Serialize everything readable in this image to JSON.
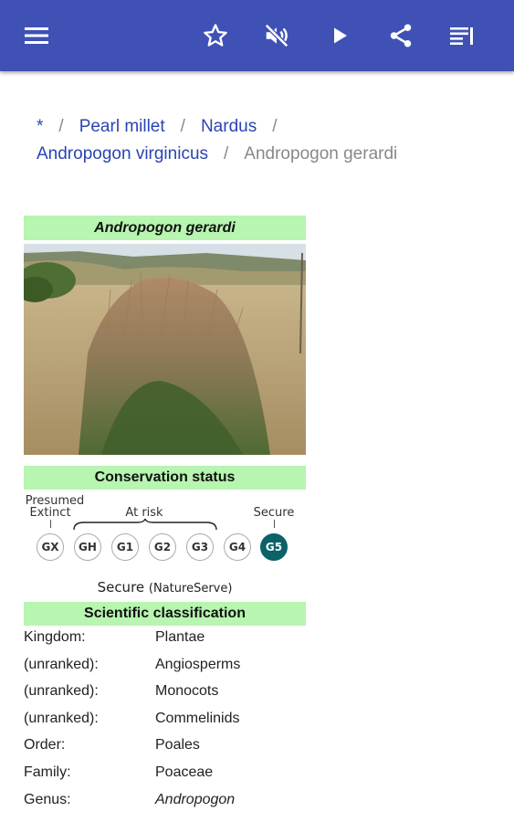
{
  "toolbar": {
    "icons": [
      "menu-icon",
      "star-icon",
      "mute-icon",
      "play-icon",
      "share-icon",
      "list-icon"
    ],
    "color": "#3f51b5"
  },
  "breadcrumb": {
    "items": [
      "*",
      "Pearl millet",
      "Nardus",
      "Andropogon virginicus"
    ],
    "current": "Andropogon gerardi",
    "separator": "/"
  },
  "infobox": {
    "title": "Andropogon gerardi",
    "conservation_header": "Conservation status",
    "status_labels": {
      "presumed": "Presumed",
      "extinct": "Extinct",
      "at_risk": "At risk",
      "secure": "Secure"
    },
    "ranks": [
      "GX",
      "GH",
      "G1",
      "G2",
      "G3",
      "G4",
      "G5"
    ],
    "active_rank": "G5",
    "status_text": "Secure",
    "status_source": "(NatureServe)",
    "classification_header": "Scientific classification",
    "classification": [
      {
        "key": "Kingdom:",
        "value": "Plantae"
      },
      {
        "key": "(unranked):",
        "value": "Angiosperms"
      },
      {
        "key": "(unranked):",
        "value": "Monocots"
      },
      {
        "key": "(unranked):",
        "value": "Commelinids"
      },
      {
        "key": "Order:",
        "value": "Poales"
      },
      {
        "key": "Family:",
        "value": "Poaceae"
      },
      {
        "key": "Genus:",
        "value": "Andropogon"
      }
    ],
    "header_color": "#b7f5b0",
    "active_rank_color": "#0b6268"
  }
}
